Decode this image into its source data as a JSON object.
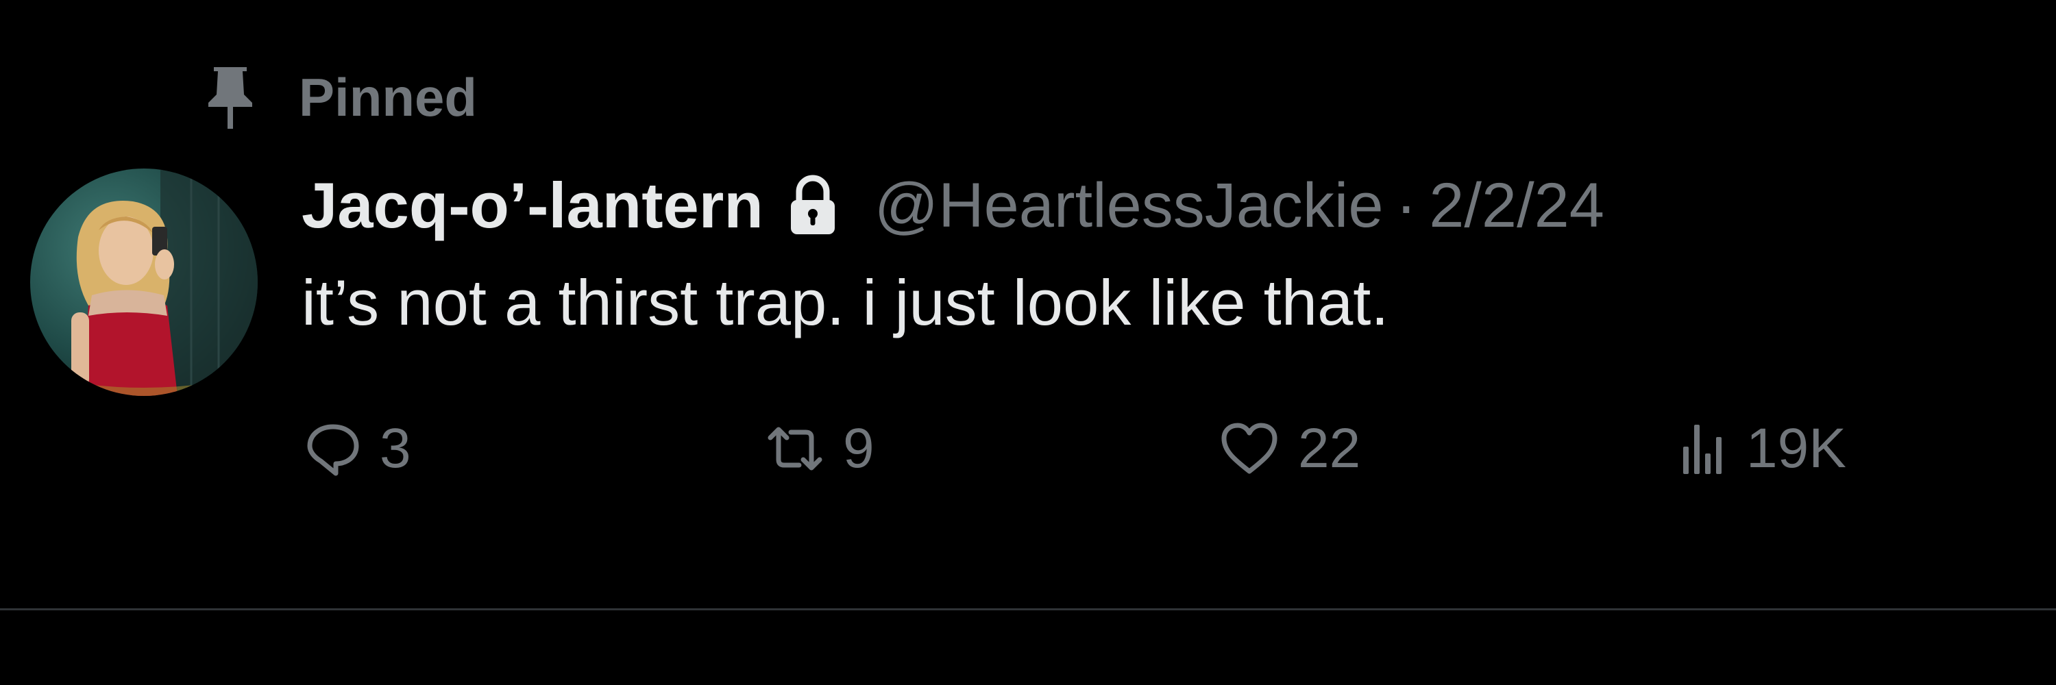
{
  "pinned": {
    "label": "Pinned",
    "icon": "pin-icon"
  },
  "author": {
    "display_name": "Jacq-o’-lantern",
    "protected_icon": "lock-icon",
    "handle": "@HeartlessJackie",
    "separator": "·",
    "date": "2/2/24"
  },
  "tweet": {
    "text": "it’s not a thirst trap. i just look like that."
  },
  "actions": {
    "reply": {
      "icon": "reply-icon",
      "count": "3"
    },
    "retweet": {
      "icon": "retweet-icon",
      "count": "9"
    },
    "like": {
      "icon": "heart-icon",
      "count": "22"
    },
    "views": {
      "icon": "views-icon",
      "count": "19K"
    }
  },
  "colors": {
    "background": "#000000",
    "primary_text": "#e7e9ea",
    "secondary_text": "#71767b",
    "divider": "#2f3336"
  }
}
